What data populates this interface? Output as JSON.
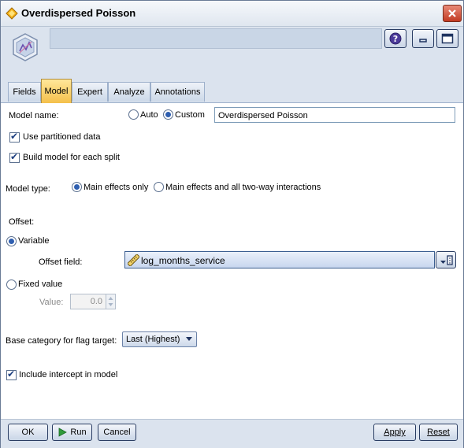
{
  "window": {
    "title": "Overdispersed Poisson"
  },
  "icons": {
    "title": "diamond-node-icon",
    "node": "model-node-icon",
    "close": "close-icon",
    "help": "help-icon",
    "minimize": "minimize-icon",
    "maximize": "maximize-icon",
    "field_picker": "field-picker-icon",
    "ruler": "ruler-icon",
    "run": "play-icon"
  },
  "colors": {
    "accent": "#f4c04b",
    "header_bg": "#dbe3ee",
    "close": "#c23a22"
  },
  "tabs": [
    {
      "label": "Fields",
      "active": false
    },
    {
      "label": "Model",
      "active": true
    },
    {
      "label": "Expert",
      "active": false
    },
    {
      "label": "Analyze",
      "active": false
    },
    {
      "label": "Annotations",
      "active": false
    }
  ],
  "model_name": {
    "label": "Model name:",
    "auto_label": "Auto",
    "custom_label": "Custom",
    "selected": "Custom",
    "value": "Overdispersed Poisson"
  },
  "use_partitioned": {
    "label": "Use partitioned data",
    "checked": true
  },
  "build_each_split": {
    "label": "Build model for each split",
    "checked": true
  },
  "model_type": {
    "label": "Model type:",
    "option_main": "Main effects only",
    "option_interactions": "Main effects and all two-way interactions",
    "selected": "Main effects only"
  },
  "offset": {
    "label": "Offset:",
    "variable_label": "Variable",
    "selected": "Variable",
    "field_label": "Offset field:",
    "field_value": "log_months_service",
    "fixed_label": "Fixed value",
    "value_label": "Value:",
    "value": "0.0"
  },
  "base_category": {
    "label": "Base category for flag target:",
    "value": "Last (Highest)"
  },
  "include_intercept": {
    "label": "Include intercept in model",
    "checked": true
  },
  "footer": {
    "ok": "OK",
    "run": "Run",
    "cancel": "Cancel",
    "apply": "Apply",
    "reset": "Reset"
  }
}
